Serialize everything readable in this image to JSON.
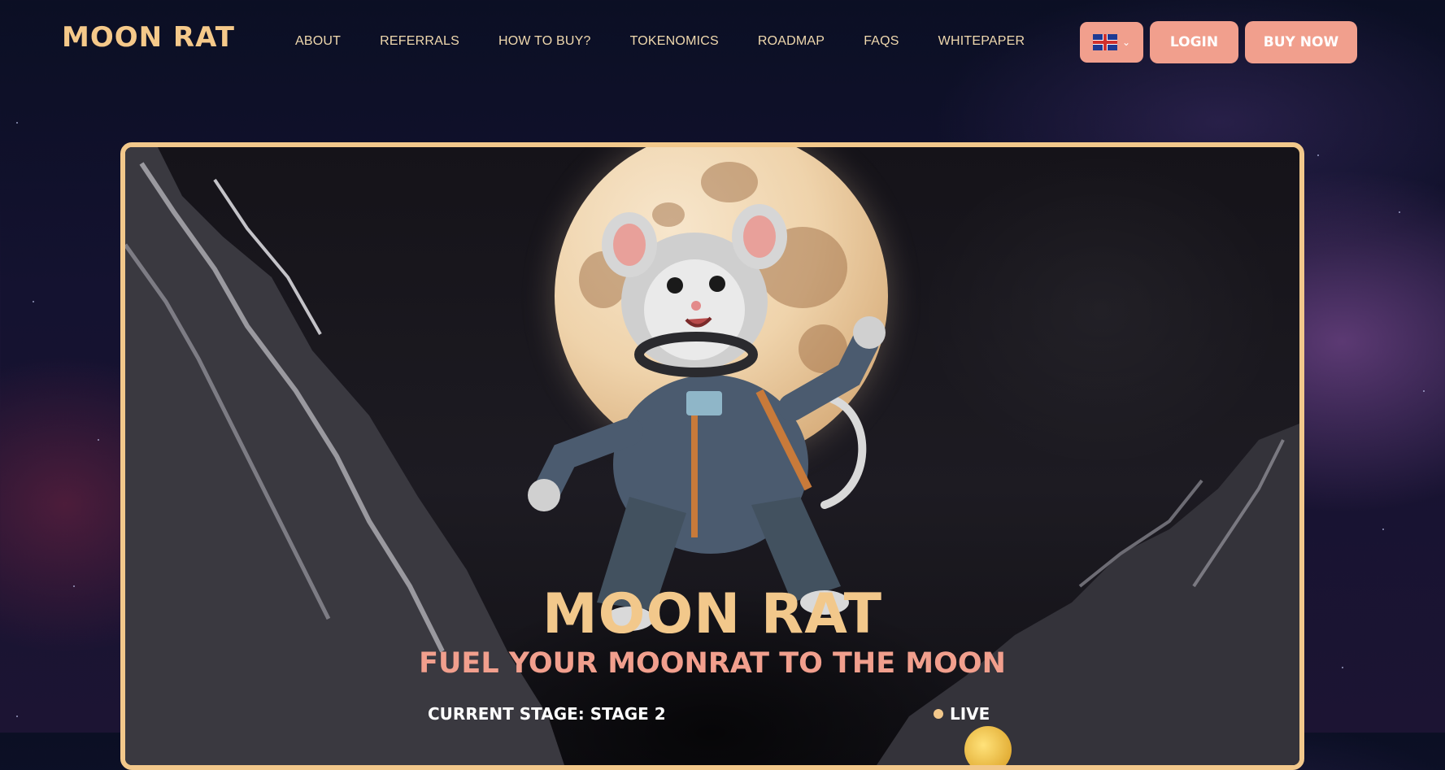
{
  "header": {
    "logo_text": "MOON RAT",
    "nav": [
      "ABOUT",
      "REFERRALS",
      "HOW TO BUY?",
      "TOKENOMICS",
      "ROADMAP",
      "FAQS",
      "WHITEPAPER"
    ],
    "language_icon": "uk-flag-icon",
    "login_label": "LOGIN",
    "buy_label": "BUY NOW"
  },
  "hero": {
    "title": "MOON RAT",
    "subtitle": "FUEL YOUR MOONRAT TO THE MOON",
    "stage_text": "CURRENT STAGE: STAGE 2",
    "live_text": "LIVE"
  },
  "colors": {
    "accent_gold": "#f2c88b",
    "accent_salmon": "#f19f8d",
    "background": "#0b0f24"
  }
}
